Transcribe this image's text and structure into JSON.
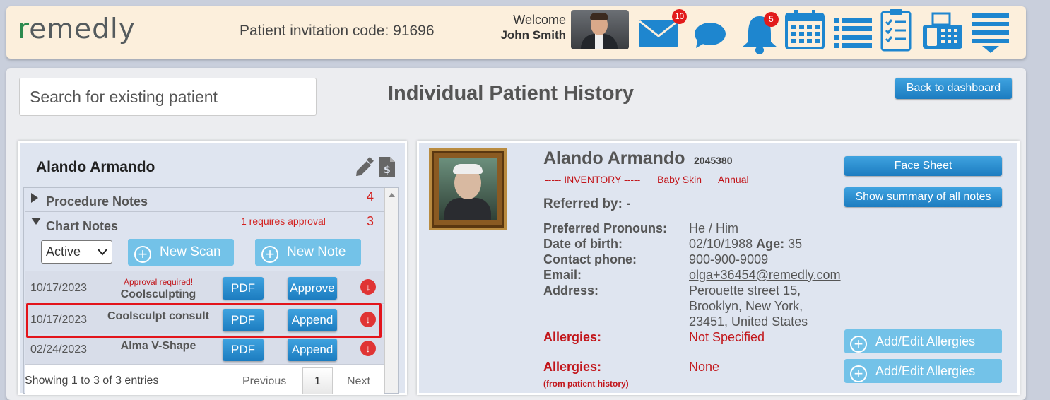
{
  "header": {
    "logo": "remedly",
    "invite_label": "Patient invitation code: 91696",
    "welcome": "Welcome",
    "user_name": "John Smith",
    "mail_count": "10",
    "notif_count": "5"
  },
  "main": {
    "search_placeholder": "Search for existing patient",
    "title": "Individual Patient History",
    "back_button": "Back to dashboard"
  },
  "left": {
    "patient_name": "Alando Armando",
    "procedure_notes": {
      "label": "Procedure Notes",
      "count": "4"
    },
    "chart_notes": {
      "label": "Chart Notes",
      "count": "3",
      "approval": "1 requires approval"
    },
    "filter_value": "Active",
    "new_scan": "New Scan",
    "new_note": "New Note",
    "rows": [
      {
        "date": "10/17/2023",
        "flag": "Approval required!",
        "desc": "Coolsculpting",
        "pdf": "PDF",
        "action": "Approve"
      },
      {
        "date": "10/17/2023",
        "flag": "",
        "desc": "Coolsculpt consult",
        "pdf": "PDF",
        "action": "Append"
      },
      {
        "date": "02/24/2023",
        "flag": "",
        "desc": "Alma V-Shape",
        "pdf": "PDF",
        "action": "Append"
      }
    ],
    "footer": {
      "showing": "Showing 1 to 3 of 3 entries",
      "previous": "Previous",
      "page": "1",
      "next": "Next"
    }
  },
  "right": {
    "name": "Alando Armando",
    "id": "2045380",
    "tags": [
      "----- INVENTORY -----",
      "Baby Skin",
      "Annual"
    ],
    "referred": "Referred by: -",
    "face_sheet": "Face Sheet",
    "summary": "Show summary of all notes",
    "fields": {
      "pronouns_label": "Preferred Pronouns:",
      "pronouns": "He / Him",
      "dob_label": "Date of birth:",
      "dob": "02/10/1988",
      "age_label": "Age:",
      "age": "35",
      "phone_label": "Contact phone:",
      "phone": "900-900-9009",
      "email_label": "Email:",
      "email": "olga+36454@remedly.com",
      "address_label": "Address:",
      "address1": "Perouette street 15,",
      "address2": "Brooklyn, New York,",
      "address3": "23451, United States",
      "allergies_label": "Allergies:",
      "allergies": "Not Specified",
      "allergies2_label": "Allergies:",
      "allergies2_sub": "(from patient history)",
      "allergies2": "None"
    },
    "add_allergies": "Add/Edit Allergies"
  }
}
